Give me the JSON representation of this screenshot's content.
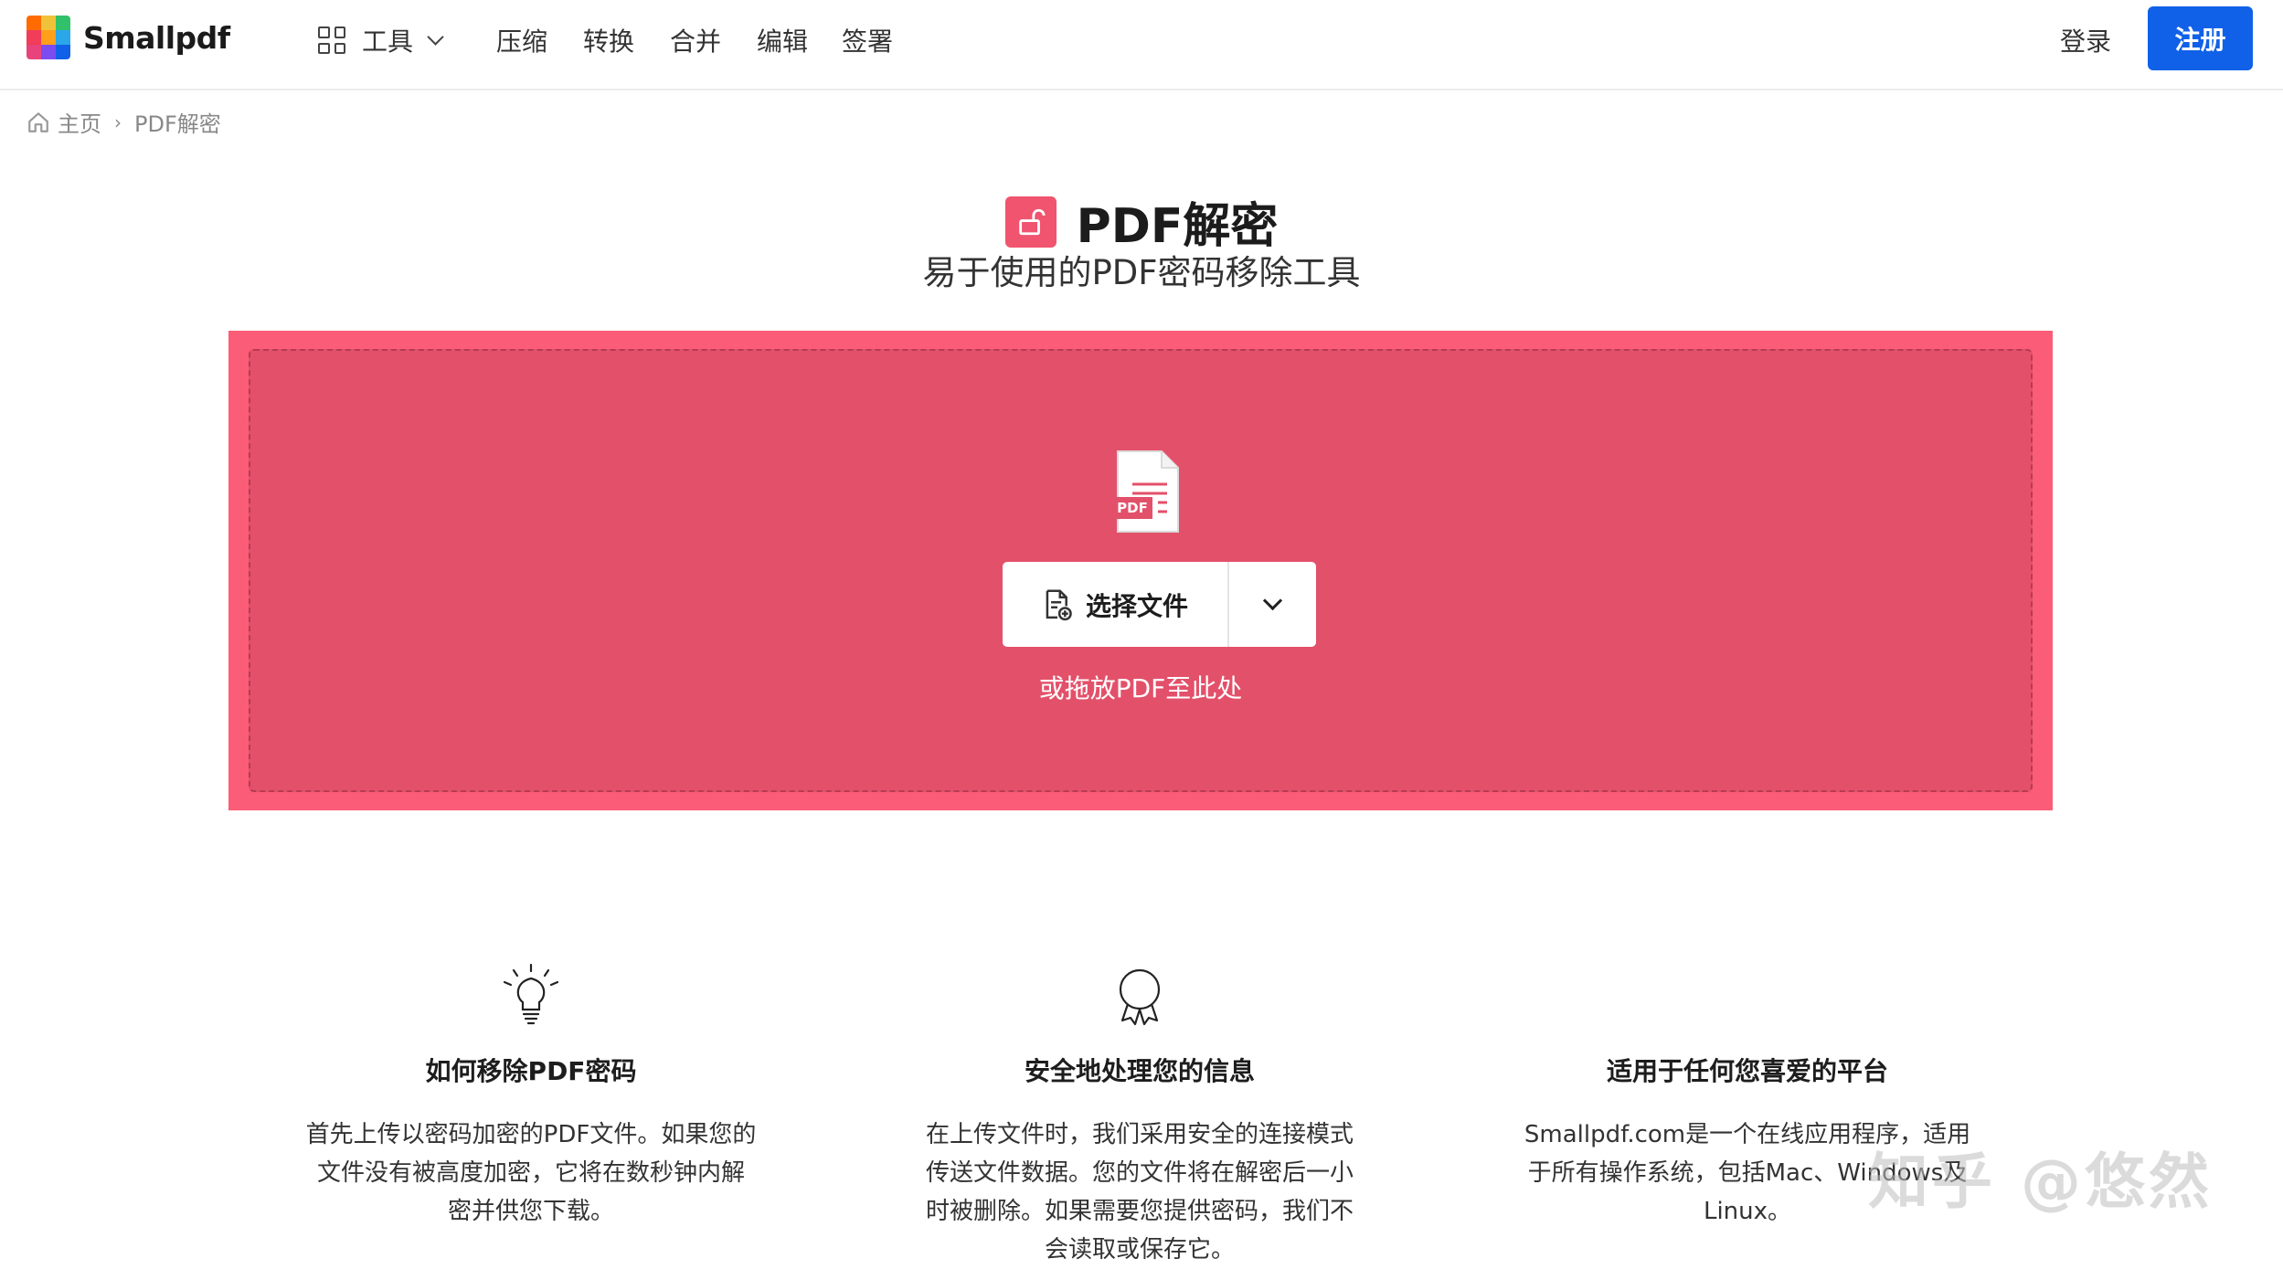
{
  "header": {
    "brand": "Smallpdf",
    "tools_label": "工具",
    "nav": [
      "压缩",
      "转换",
      "合并",
      "编辑",
      "签署"
    ],
    "login": "登录",
    "signup": "注册",
    "brand_colors": [
      "#ff6b00",
      "#2ba6e8",
      "#f0c23a",
      "#f13c5a",
      "#7b4cf0",
      "#31c16a",
      "#e9437b",
      "#1061e8",
      "#ff9f1a"
    ]
  },
  "breadcrumb": {
    "home": "主页",
    "separator": "›",
    "current": "PDF解密"
  },
  "hero": {
    "title": "PDF解密",
    "subtitle": "易于使用的PDF密码移除工具",
    "accent_color": "#f0546e"
  },
  "dropzone": {
    "file_badge": "PDF",
    "choose_label": "选择文件",
    "hint": "或拖放PDF至此处",
    "outer_color": "#fb5c78",
    "inner_color": "#e3506a"
  },
  "features": [
    {
      "icon": "lightbulb-icon",
      "title": "如何移除PDF密码",
      "lines": [
        "首先上传以密码加密的PDF文件。如果您的",
        "文件没有被高度加密，它将在数秒钟内解",
        "密并供您下载。"
      ]
    },
    {
      "icon": "award-icon",
      "title": "安全地处理您的信息",
      "lines": [
        "在上传文件时，我们采用安全的连接模式",
        "传送文件数据。您的文件将在解密后一小",
        "时被删除。如果需要您提供密码，我们不",
        "会读取或保存它。"
      ]
    },
    {
      "icon": "",
      "title": "适用于任何您喜爱的平台",
      "lines": [
        "Smallpdf.com是一个在线应用程序，适用",
        "于所有操作系统，包括Mac、Windows及",
        "Linux。"
      ]
    }
  ],
  "watermark": "知乎 @悠然"
}
